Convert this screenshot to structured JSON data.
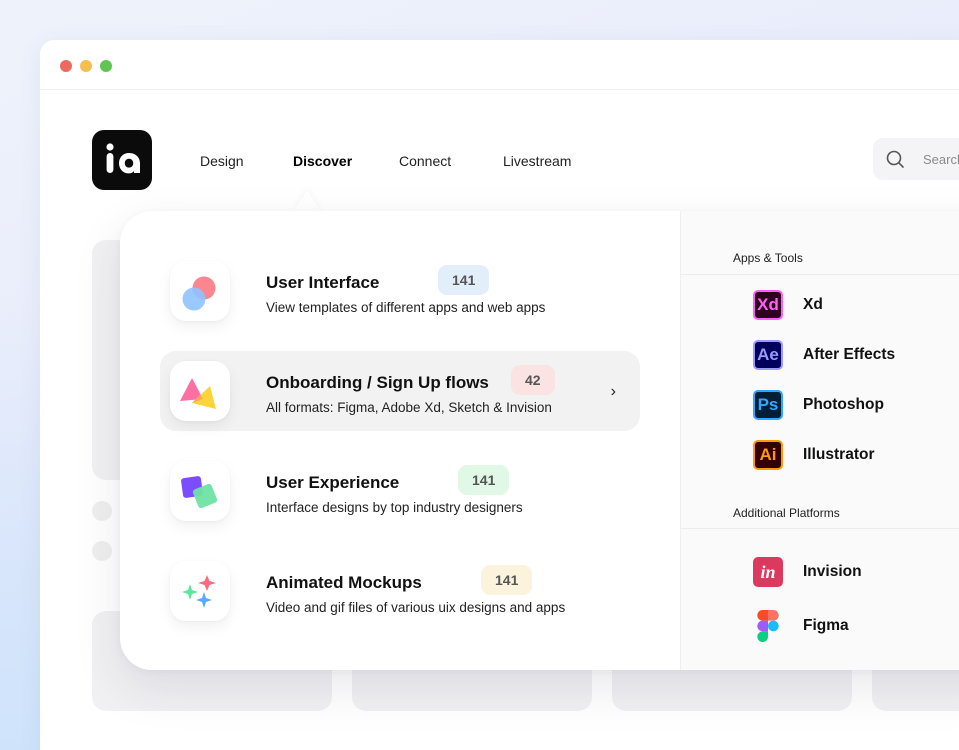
{
  "window": {
    "controls": [
      "close",
      "minimize",
      "maximize"
    ]
  },
  "logo": {
    "text": "ia"
  },
  "nav": [
    {
      "label": "Design",
      "active": false
    },
    {
      "label": "Discover",
      "active": true
    },
    {
      "label": "Connect",
      "active": false
    },
    {
      "label": "Livestream",
      "active": false
    }
  ],
  "search": {
    "placeholder": "Search",
    "icon": "search-icon"
  },
  "dropdown": {
    "categories": [
      {
        "title": "User Interface",
        "count": "141",
        "badge_color": "#e3eefb",
        "description": "View templates of different apps and web apps",
        "icon": "circles-icon",
        "hovered": false
      },
      {
        "title": "Onboarding / Sign Up flows",
        "count": "42",
        "badge_color": "#fbe3e3",
        "description": "All formats: Figma, Adobe Xd, Sketch & Invision",
        "icon": "triangles-icon",
        "hovered": true,
        "chevron": "›"
      },
      {
        "title": "User Experience",
        "count": "141",
        "badge_color": "#e1f8e6",
        "description": "Interface designs by top industry designers",
        "icon": "squares-icon",
        "hovered": false
      },
      {
        "title": "Animated Mockups",
        "count": "141",
        "badge_color": "#fbf3dc",
        "description": "Video and gif files of various uix designs and apps",
        "icon": "stars-icon",
        "hovered": false
      }
    ],
    "apps_tools": {
      "label": "Apps & Tools",
      "items": [
        {
          "abbr": "Xd",
          "name": "Xd",
          "bg": "#2e001f",
          "fg": "#ff61f6"
        },
        {
          "abbr": "Ae",
          "name": "After Effects",
          "bg": "#00005b",
          "fg": "#9999ff"
        },
        {
          "abbr": "Ps",
          "name": "Photoshop",
          "bg": "#001e36",
          "fg": "#31a8ff"
        },
        {
          "abbr": "Ai",
          "name": "Illustrator",
          "bg": "#330000",
          "fg": "#ff9a00"
        }
      ]
    },
    "additional_platforms": {
      "label": "Additional Platforms",
      "items": [
        {
          "abbr": "in",
          "name": "Invision",
          "bg": "#dc395f",
          "fg": "#ffffff"
        },
        {
          "abbr": "",
          "name": "Figma",
          "bg": "",
          "fg": ""
        }
      ]
    }
  }
}
